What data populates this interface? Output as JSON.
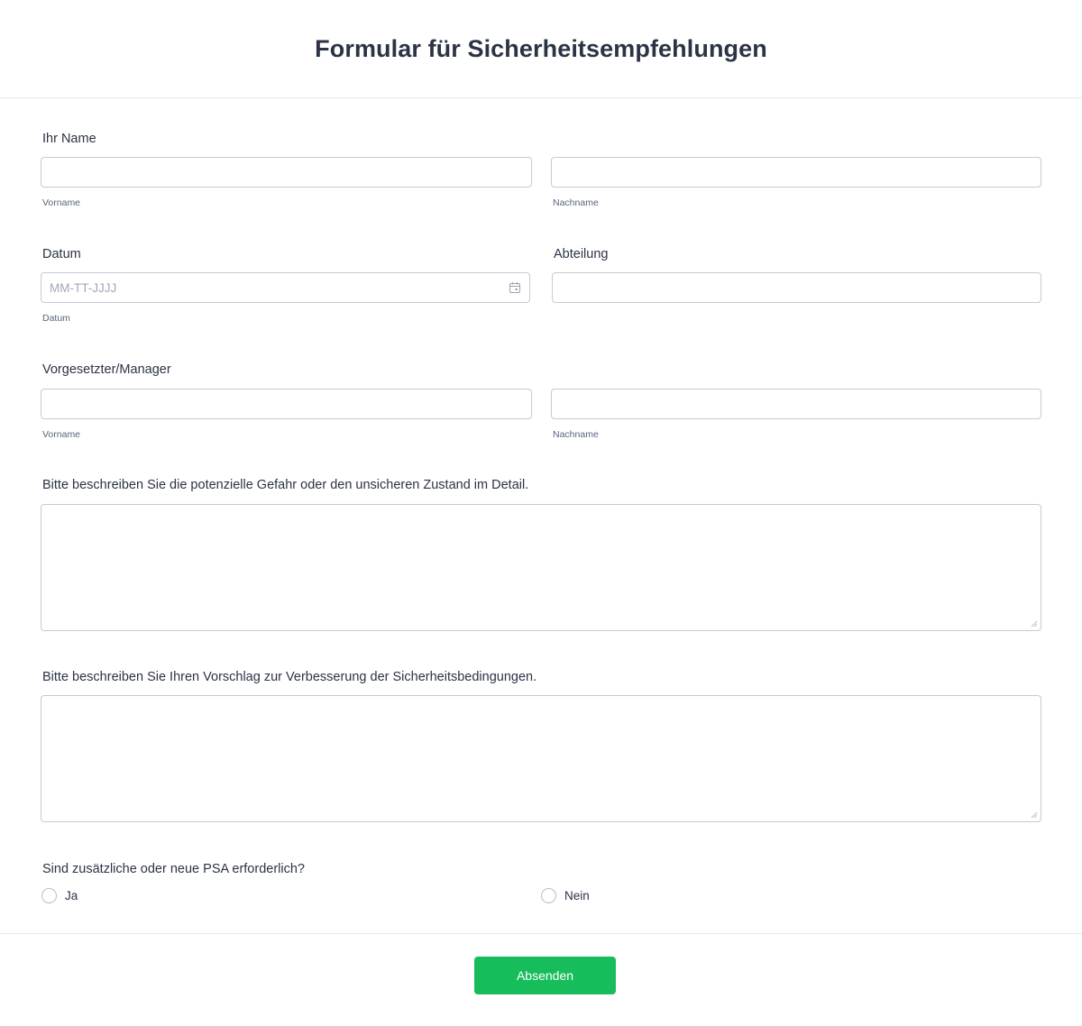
{
  "form": {
    "title": "Formular für Sicherheitsempfehlungen"
  },
  "name_field": {
    "label": "Ihr Name",
    "first_sublabel": "Vorname",
    "last_sublabel": "Nachname"
  },
  "date_field": {
    "label": "Datum",
    "placeholder": "MM-TT-JJJJ",
    "sublabel": "Datum",
    "icon": "calendar-icon"
  },
  "department_field": {
    "label": "Abteilung"
  },
  "manager_field": {
    "label": "Vorgesetzter/Manager",
    "first_sublabel": "Vorname",
    "last_sublabel": "Nachname"
  },
  "hazard_field": {
    "label": "Bitte beschreiben Sie die potenzielle Gefahr oder den unsicheren Zustand im Detail."
  },
  "suggestion_field": {
    "label": "Bitte beschreiben Sie Ihren Vorschlag zur Verbesserung der Sicherheitsbedingungen."
  },
  "ppe_field": {
    "label": "Sind zusätzliche oder neue PSA erforderlich?",
    "options": [
      "Ja",
      "Nein"
    ]
  },
  "submit": {
    "label": "Absenden",
    "color": "#18bd5b"
  }
}
